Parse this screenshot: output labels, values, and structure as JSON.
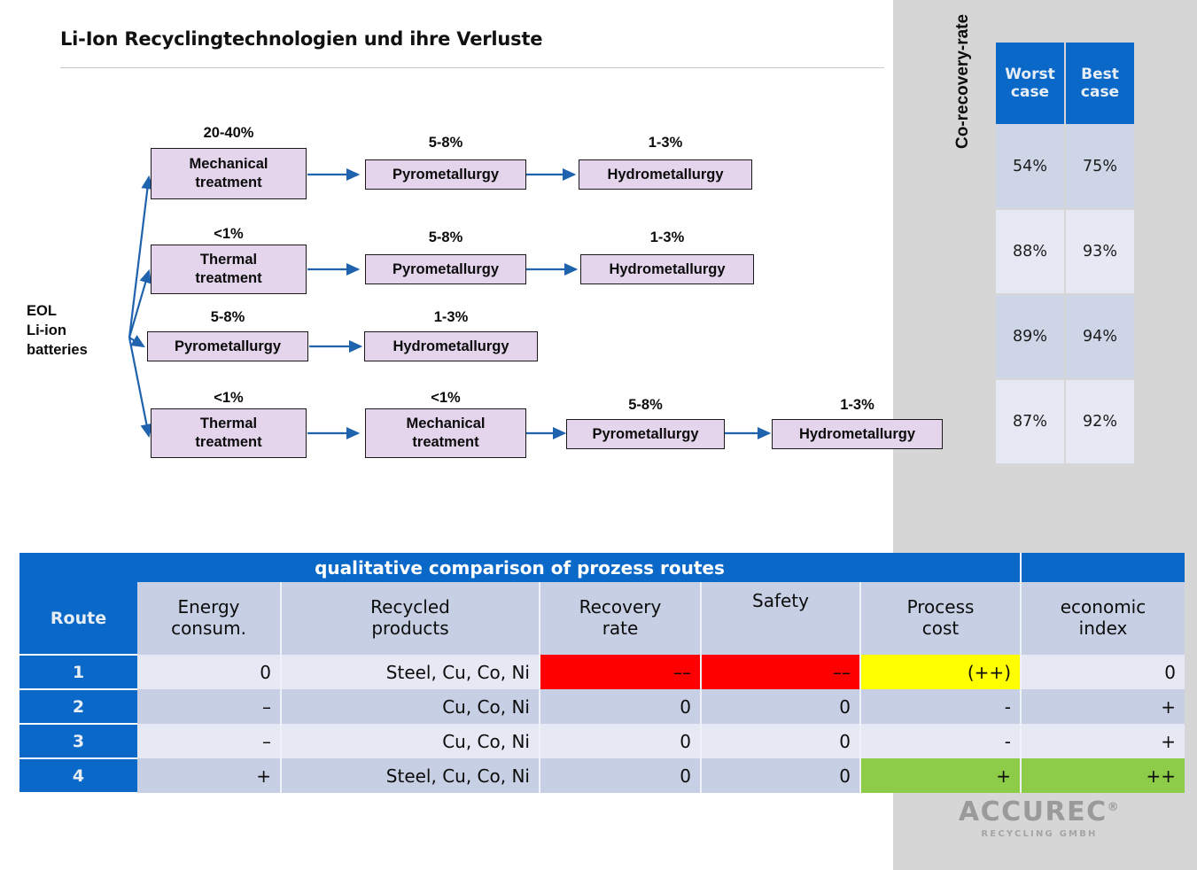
{
  "page_title": "Li-Ion Recyclingtechnologien und ihre Verluste",
  "flow": {
    "source_label": "EOL\nLi-ion\nbatteries",
    "source_lines": [
      "EOL",
      "Li-ion",
      "batteries"
    ],
    "routes": [
      {
        "route": 1,
        "steps": [
          {
            "label": "Mechanical\ntreatment",
            "loss": "20-40%"
          },
          {
            "label": "Pyrometallurgy",
            "loss": "5-8%"
          },
          {
            "label": "Hydrometallurgy",
            "loss": "1-3%"
          }
        ]
      },
      {
        "route": 2,
        "steps": [
          {
            "label": "Thermal\ntreatment",
            "loss": "<1%"
          },
          {
            "label": "Pyrometallurgy",
            "loss": "5-8%"
          },
          {
            "label": "Hydrometallurgy",
            "loss": "1-3%"
          }
        ]
      },
      {
        "route": 3,
        "steps": [
          {
            "label": "Pyrometallurgy",
            "loss": "5-8%"
          },
          {
            "label": "Hydrometallurgy",
            "loss": "1-3%"
          }
        ]
      },
      {
        "route": 4,
        "steps": [
          {
            "label": "Thermal\ntreatment",
            "loss": "<1%"
          },
          {
            "label": "Mechanical\ntreatment",
            "loss": "<1%"
          },
          {
            "label": "Pyrometallurgy",
            "loss": "5-8%"
          },
          {
            "label": "Hydrometallurgy",
            "loss": "1-3%"
          }
        ]
      }
    ],
    "node_fill": "#E4D5EC",
    "arrow_color": "#1F62AD"
  },
  "recovery": {
    "axis_label": "Co-recovery-rate",
    "headers": [
      "Worst\ncase",
      "Best\ncase"
    ],
    "header_worst_l1": "Worst",
    "header_worst_l2": "case",
    "header_best_l1": "Best",
    "header_best_l2": "case",
    "rows": [
      {
        "worst": "54%",
        "best": "75%"
      },
      {
        "worst": "88%",
        "best": "93%"
      },
      {
        "worst": "89%",
        "best": "94%"
      },
      {
        "worst": "87%",
        "best": "92%"
      }
    ],
    "header_bg": "#0A68C8"
  },
  "comparison": {
    "title": "qualitative comparison of prozess routes",
    "columns": [
      {
        "key": "route",
        "l1": "Route",
        "l2": ""
      },
      {
        "key": "energy",
        "l1": "Energy",
        "l2": "consum."
      },
      {
        "key": "products",
        "l1": "Recycled",
        "l2": "products"
      },
      {
        "key": "recovery",
        "l1": "Recovery",
        "l2": "rate"
      },
      {
        "key": "safety",
        "l1": "Safety",
        "l2": ""
      },
      {
        "key": "cost",
        "l1": "Process",
        "l2": "cost"
      },
      {
        "key": "index",
        "l1": "economic",
        "l2": "index"
      }
    ],
    "rows": [
      {
        "route": "1",
        "energy": "0",
        "products": "Steel, Cu, Co, Ni",
        "recovery": "––",
        "safety": "––",
        "cost": "(++)",
        "index": "0"
      },
      {
        "route": "2",
        "energy": "–",
        "products": "Cu, Co, Ni",
        "recovery": "0",
        "safety": "0",
        "cost": "-",
        "index": "+"
      },
      {
        "route": "3",
        "energy": "–",
        "products": "Cu, Co, Ni",
        "recovery": "0",
        "safety": "0",
        "cost": "-",
        "index": "+"
      },
      {
        "route": "4",
        "energy": "+",
        "products": "Steel, Cu, Co, Ni",
        "recovery": "0",
        "safety": "0",
        "cost": "+",
        "index": "++"
      }
    ],
    "highlight_red": "#FF0000",
    "highlight_yellow": "#FFFF00",
    "highlight_green": "#8CCC48",
    "header_bg": "#0A68C8"
  },
  "logo": {
    "name": "ACCUREC",
    "registered": "®",
    "subtitle": "RECYCLING GMBH"
  }
}
